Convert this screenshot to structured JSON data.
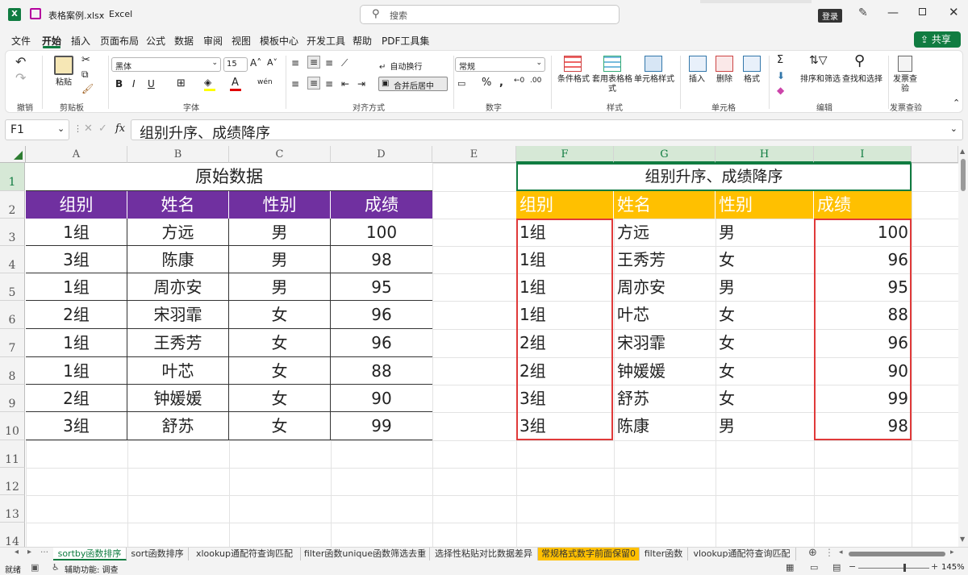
{
  "titlebar": {
    "filename": "表格案例.xlsx",
    "app": "Excel",
    "search_placeholder": "搜索",
    "login": "登录"
  },
  "menu": [
    "文件",
    "开始",
    "插入",
    "页面布局",
    "公式",
    "数据",
    "审阅",
    "视图",
    "模板中心",
    "开发工具",
    "帮助",
    "PDF工具集"
  ],
  "share": "共享",
  "ribbon": {
    "undo_group": "撤销",
    "clipboard": "剪贴板",
    "paste": "粘贴",
    "font_group": "字体",
    "font_name": "黑体",
    "font_size": "15",
    "align_group": "对齐方式",
    "wrap": "自动换行",
    "merge": "合并后居中",
    "number_group": "数字",
    "number_format": "常规",
    "styles_group": "样式",
    "cond_format": "条件格式",
    "table_format": "套用表格格式",
    "cell_style": "单元格样式",
    "cells_group": "单元格",
    "insert": "插入",
    "delete": "删除",
    "format": "格式",
    "edit_group": "编辑",
    "sort_filter": "排序和筛选",
    "find_select": "查找和选择",
    "invoice_group": "发票查验",
    "invoice_check": "发票查验"
  },
  "formula_bar": {
    "name_box": "F1",
    "fx": "fx",
    "content": "组别升序、成绩降序"
  },
  "columns": [
    "A",
    "B",
    "C",
    "D",
    "E",
    "F",
    "G",
    "H",
    "I"
  ],
  "rows": [
    "1",
    "2",
    "3",
    "4",
    "5",
    "6",
    "7",
    "8",
    "9",
    "10",
    "11",
    "12",
    "13",
    "14"
  ],
  "left_table": {
    "title": "原始数据",
    "headers": [
      "组别",
      "姓名",
      "性别",
      "成绩"
    ],
    "rows": [
      [
        "1组",
        "方远",
        "男",
        "100"
      ],
      [
        "3组",
        "陈康",
        "男",
        "98"
      ],
      [
        "1组",
        "周亦安",
        "男",
        "95"
      ],
      [
        "2组",
        "宋羽霏",
        "女",
        "96"
      ],
      [
        "1组",
        "王秀芳",
        "女",
        "96"
      ],
      [
        "1组",
        "叶芯",
        "女",
        "88"
      ],
      [
        "2组",
        "钟媛媛",
        "女",
        "90"
      ],
      [
        "3组",
        "舒苏",
        "女",
        "99"
      ]
    ]
  },
  "right_table": {
    "title": "组别升序、成绩降序",
    "headers": [
      "组别",
      "姓名",
      "性别",
      "成绩"
    ],
    "rows": [
      [
        "1组",
        "方远",
        "男",
        "100"
      ],
      [
        "1组",
        "王秀芳",
        "女",
        "96"
      ],
      [
        "1组",
        "周亦安",
        "男",
        "95"
      ],
      [
        "1组",
        "叶芯",
        "女",
        "88"
      ],
      [
        "2组",
        "宋羽霏",
        "女",
        "96"
      ],
      [
        "2组",
        "钟媛媛",
        "女",
        "90"
      ],
      [
        "3组",
        "舒苏",
        "女",
        "99"
      ],
      [
        "3组",
        "陈康",
        "男",
        "98"
      ]
    ]
  },
  "colors": {
    "left_header_bg": "#7030a0",
    "right_header_bg": "#ffc000",
    "highlight_border": "#e03a3a",
    "active_tab": "#00a651",
    "accent_green": "#107c41",
    "yellow_tab": "#ffc000"
  },
  "sheet_tabs": [
    "sortby函数排序",
    "sort函数排序",
    "xlookup通配符查询匹配",
    "filter函数unique函数筛选去重",
    "选择性粘贴对比数据差异",
    "常规格式数字前面保留0",
    "filter函数",
    "vlookup通配符查询匹配"
  ],
  "status": {
    "ready": "就绪",
    "accessibility": "辅助功能: 调查",
    "zoom": "145%"
  }
}
